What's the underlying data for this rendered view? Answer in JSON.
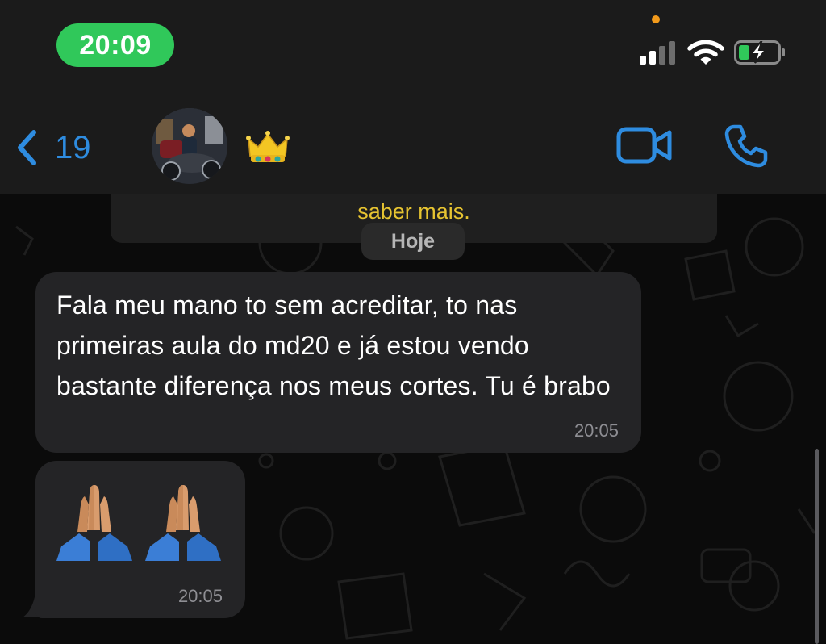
{
  "status": {
    "time": "20:09"
  },
  "header": {
    "back_count": "19",
    "contact_emoji": "👑"
  },
  "chat": {
    "previous_message_link": "saber mais.",
    "date_divider": "Hoje",
    "messages": [
      {
        "text": "Fala meu mano to sem acreditar, to nas primeiras aula do md20 e já estou vendo bastante diferença nos meus cortes. Tu é brabo",
        "time": "20:05"
      },
      {
        "emoji": "🙏🙏",
        "time": "20:05"
      }
    ]
  },
  "colors": {
    "accent": "#2e8ce0",
    "status_pill": "#30c85a",
    "bubble": "#242426",
    "link": "#e7c431"
  }
}
